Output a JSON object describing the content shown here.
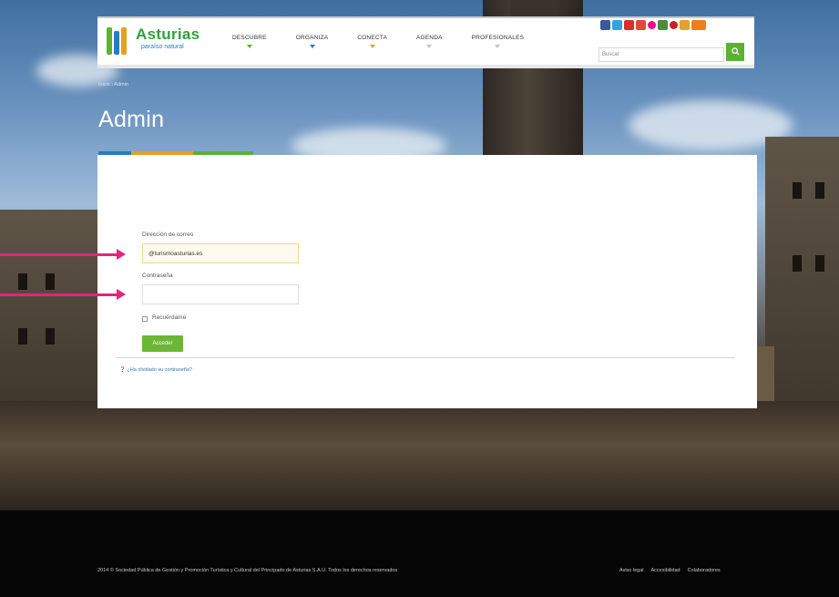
{
  "header": {
    "logo_title": "Asturias",
    "logo_subtitle": "paraíso natural",
    "nav": [
      {
        "label": "Descubre",
        "color": "#5cb033"
      },
      {
        "label": "Organiza",
        "color": "#2b7bbf"
      },
      {
        "label": "Conecta",
        "color": "#e3a21a"
      },
      {
        "label": "Agenda",
        "color": "#c4c4c4"
      },
      {
        "label": "Profesionales",
        "color": "#c4c4c4"
      }
    ],
    "social_icons": [
      {
        "name": "facebook-icon",
        "color": "#3b5998"
      },
      {
        "name": "twitter-icon",
        "color": "#2fa7de"
      },
      {
        "name": "youtube-icon",
        "color": "#d9302c"
      },
      {
        "name": "google-plus-icon",
        "color": "#dd4b39"
      },
      {
        "name": "flickr-icon",
        "color": "#ff0084"
      },
      {
        "name": "tripadvisor-icon",
        "color": "#4a8c3b"
      },
      {
        "name": "pinterest-icon",
        "color": "#cb2027"
      },
      {
        "name": "instagram-icon",
        "color": "#e89f2b"
      },
      {
        "name": "blog-icon",
        "color": "#f07e1b"
      }
    ],
    "search_placeholder": "Buscar",
    "search_button_icon": "search-icon"
  },
  "breadcrumb": "Inicio › Admin",
  "page_title": "Admin",
  "title_accent_colors": [
    "#2b7bbf",
    "#e3a21a",
    "#5cb033"
  ],
  "form": {
    "email_label": "Dirección de correo",
    "email_value": "@turismoasturias.es",
    "password_label": "Contraseña",
    "password_value": "",
    "remember_label": "Recuérdame",
    "remember_checked": false,
    "login_button": "Acceder",
    "forgot_link": "¿Ha olvidado su contraseña?"
  },
  "footer": {
    "copyright": "2014 © Sociedad Pública de Gestión y Promoción Turística y Cultural del Principado de Asturias S.A.U. Todos los derechos reservados",
    "links": [
      "Aviso legal",
      "Accesibilidad",
      "Colaboradores"
    ]
  },
  "annotation_color": "#e5247a"
}
